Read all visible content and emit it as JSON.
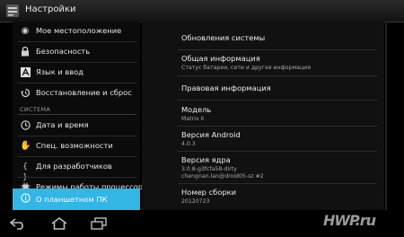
{
  "header": {
    "title": "Настройки"
  },
  "sidebar": {
    "items": [
      {
        "label": "Мое местоположение",
        "icon": "location-icon"
      },
      {
        "label": "Безопасность",
        "icon": "lock-icon"
      },
      {
        "label": "Язык и ввод",
        "icon": "language-icon"
      },
      {
        "label": "Восстановление и сброс",
        "icon": "restore-icon"
      }
    ],
    "section_title": "СИСТЕМА",
    "system_items": [
      {
        "label": "Дата и время",
        "icon": "clock-icon"
      },
      {
        "label": "Спец. возможности",
        "icon": "accessibility-icon"
      },
      {
        "label": "Для разработчиков",
        "icon": "developer-icon"
      },
      {
        "label": "Режимы работы процессора",
        "icon": "cpu-icon"
      },
      {
        "label": "О планшетном ПК",
        "icon": "info-icon",
        "selected": true
      }
    ]
  },
  "content": {
    "rows": [
      {
        "title": "Обновления системы"
      },
      {
        "title": "Общая информация",
        "subtitle": "Статус батареи, сети и другая информация"
      },
      {
        "title": "Правовая информация"
      },
      {
        "title": "Модель",
        "value": "Matrix II"
      },
      {
        "title": "Версия Android",
        "value": "4.0.3"
      },
      {
        "title": "Версия ядра",
        "value": "3.0.8-g3fcfa58-dirty",
        "value2": "chengnan.lan@droid05-sz #2"
      },
      {
        "title": "Номер сборки",
        "value": "20120723"
      }
    ]
  },
  "navbar": {
    "buttons": [
      "back-icon",
      "home-icon",
      "recent-apps-icon"
    ]
  },
  "watermark": "HWP.ru",
  "colors": {
    "accent": "#33b5e5",
    "background": "#000000",
    "panel": "#111111"
  }
}
